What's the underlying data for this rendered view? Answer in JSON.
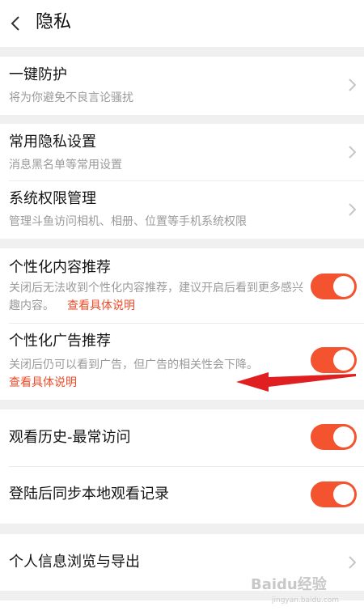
{
  "header": {
    "title": "隐私"
  },
  "sections": {
    "protection": {
      "title": "一键防护",
      "subtitle": "将为你避免不良言论骚扰"
    },
    "common_privacy": {
      "title": "常用隐私设置",
      "subtitle": "消息黑名单等常用设置"
    },
    "permissions": {
      "title": "系统权限管理",
      "subtitle": "管理斗鱼访问相机、相册、位置等手机系统权限"
    },
    "personalized_content": {
      "title": "个性化内容推荐",
      "desc": "关闭后无法收到个性化内容推荐，建议开启后看到更多感兴趣内容。",
      "link": "查看具体说明",
      "enabled": true
    },
    "personalized_ads": {
      "title": "个性化广告推荐",
      "desc": "关闭后仍可以看到广告，但广告的相关性会下降。",
      "link": "查看具体说明",
      "enabled": true
    },
    "watch_history": {
      "title": "观看历史-最常访问",
      "enabled": true
    },
    "sync_records": {
      "title": "登陆后同步本地观看记录",
      "enabled": true
    },
    "personal_info": {
      "title": "个人信息浏览与导出"
    }
  },
  "watermark": {
    "text": "Baidu经验",
    "sub": "jingyan.baidu.com"
  },
  "colors": {
    "accent": "#f4532f",
    "link": "#ef4b2a",
    "annotation_arrow": "#e02020"
  }
}
